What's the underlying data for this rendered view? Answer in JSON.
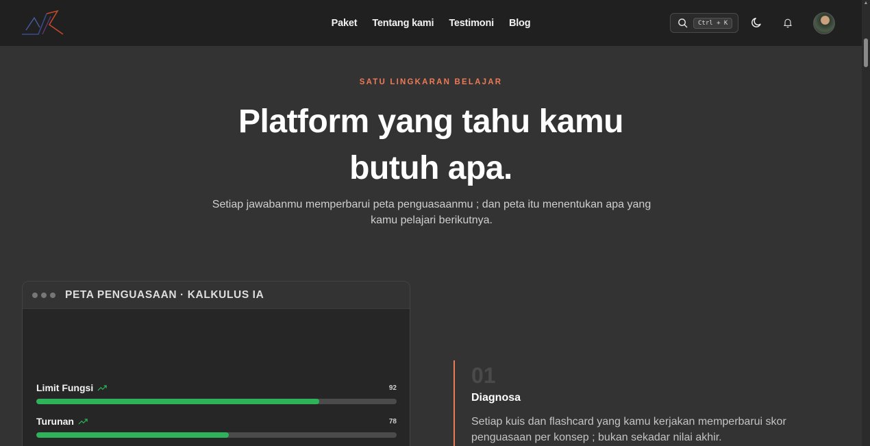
{
  "nav": {
    "items": [
      {
        "label": "Paket"
      },
      {
        "label": "Tentang kami"
      },
      {
        "label": "Testimoni"
      },
      {
        "label": "Blog"
      }
    ],
    "search_shortcut": "Ctrl + K"
  },
  "hero": {
    "eyebrow": "SATU LINGKARAN BELAJAR",
    "title_line1": "Platform yang tahu kamu",
    "title_line2": "butuh apa.",
    "subtitle": "Setiap jawabanmu memperbarui peta penguasaanmu ; dan peta itu menentukan apa yang kamu pelajari berikutnya."
  },
  "mastery_card": {
    "title": "PETA PENGUASAAN · KALKULUS IA",
    "concepts": [
      {
        "name": "Limit Fungsi",
        "score": "92",
        "progress": 0.785
      },
      {
        "name": "Turunan",
        "score": "78",
        "progress": 0.535
      }
    ]
  },
  "step": {
    "number": "01",
    "title": "Diagnosa",
    "description": "Setiap kuis dan flashcard yang kamu kerjakan memperbarui skor penguasaan per konsep ; bukan sekadar nilai akhir."
  },
  "colors": {
    "accent": "#ee7b55",
    "progress": "#2fb35a",
    "background": "#333333",
    "header": "#202020"
  }
}
